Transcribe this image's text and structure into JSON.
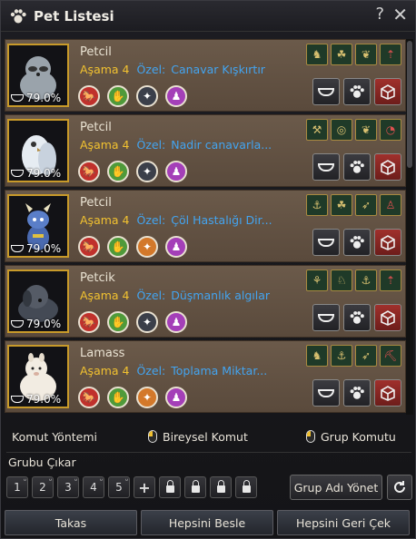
{
  "window": {
    "title": "Pet Listesi",
    "help_label": "?",
    "close_label": "✕"
  },
  "pets": [
    {
      "name": "Petcil",
      "stage_label": "Aşama",
      "stage": "4",
      "special_label": "Özel:",
      "special": "Canavar Kışkırtır",
      "loyalty": "79.0%",
      "portrait": "raccoon",
      "fur": "#9aa3ab",
      "skills": [
        "red",
        "green",
        "grey",
        "purple"
      ],
      "traits": [
        "horse-icon",
        "clover-icon",
        "wing-icon",
        "arrow-up-icon"
      ]
    },
    {
      "name": "Petcil",
      "stage_label": "Aşama",
      "stage": "4",
      "special_label": "Özel:",
      "special": "Nadir canavarla...",
      "loyalty": "79.0%",
      "portrait": "owl",
      "fur": "#e6ecf2",
      "skills": [
        "red",
        "green",
        "grey",
        "purple"
      ],
      "traits": [
        "shovel-icon",
        "target-icon",
        "wing-icon",
        "pie-icon"
      ]
    },
    {
      "name": "Petcil",
      "stage_label": "Aşama",
      "stage": "4",
      "special_label": "Özel:",
      "special": "Çöl Hastalığı Dir...",
      "loyalty": "79.0%",
      "portrait": "dragon",
      "fur": "#4a6ab0",
      "skills": [
        "red",
        "green",
        "orange",
        "purple"
      ],
      "traits": [
        "anchor-icon",
        "clover-icon",
        "bow-icon",
        "person-icon"
      ]
    },
    {
      "name": "Petcik",
      "stage_label": "Aşama",
      "stage": "4",
      "special_label": "Özel:",
      "special": "Düşmanlık algılar",
      "loyalty": "79.0%",
      "portrait": "dog",
      "fur": "#444a55",
      "skills": [
        "red",
        "green",
        "grey",
        "purple"
      ],
      "traits": [
        "wheat-icon",
        "stag-icon",
        "anchor-icon",
        "arrow-up-icon"
      ]
    },
    {
      "name": "Lamass",
      "stage_label": "Aşama",
      "stage": "4",
      "special_label": "Özel:",
      "special": "Toplama Miktar...",
      "loyalty": "79.0%",
      "portrait": "alpaca",
      "fur": "#f2ece2",
      "skills": [
        "red",
        "green",
        "orange",
        "purple"
      ],
      "traits": [
        "horse-icon",
        "anchor-icon",
        "bow-icon",
        "pickaxe-icon"
      ]
    }
  ],
  "command": {
    "label": "Komut Yöntemi",
    "individual": "Bireysel Komut",
    "group": "Grup Komutu"
  },
  "group": {
    "label": "Grubu Çıkar",
    "slots": [
      "1",
      "2",
      "3",
      "4",
      "5"
    ],
    "add": "+",
    "locked_count": 4,
    "name_button": "Grup Adı Yönet"
  },
  "footer": {
    "trade": "Takas",
    "feed_all": "Hepsini Besle",
    "recall_all": "Hepsini Geri Çek"
  },
  "colors": {
    "stage": "#f2c230",
    "special": "#43a4f0",
    "portrait_border": "#c89a2a"
  }
}
